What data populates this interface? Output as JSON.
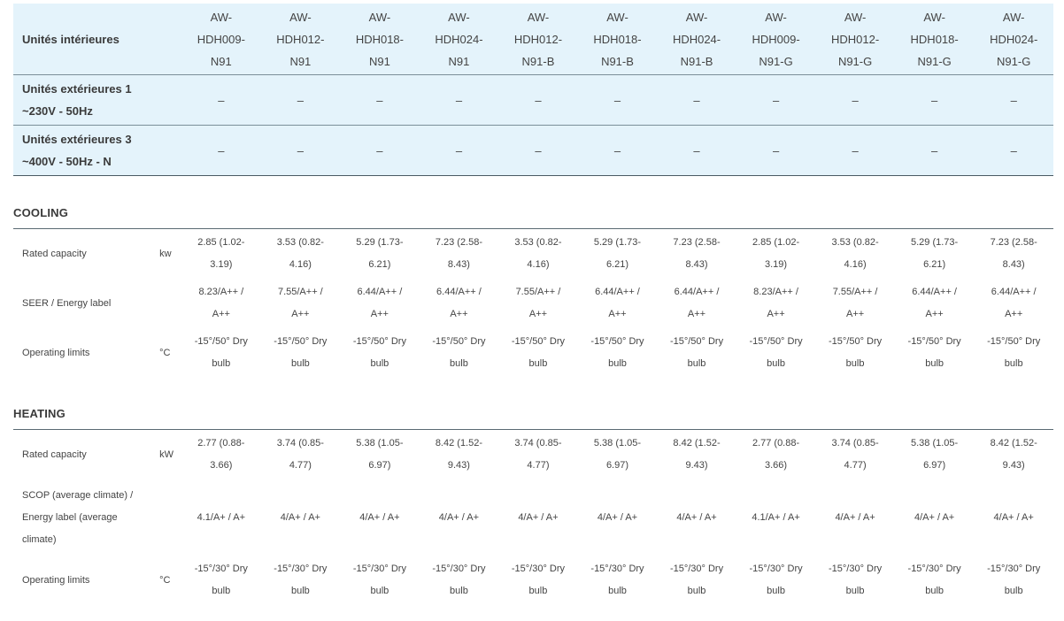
{
  "header": {
    "indoor_label": "Unités intérieures",
    "models": [
      [
        "AW-",
        "HDH009-",
        "N91"
      ],
      [
        "AW-",
        "HDH012-",
        "N91"
      ],
      [
        "AW-",
        "HDH018-",
        "N91"
      ],
      [
        "AW-",
        "HDH024-",
        "N91"
      ],
      [
        "AW-",
        "HDH012-",
        "N91-B"
      ],
      [
        "AW-",
        "HDH018-",
        "N91-B"
      ],
      [
        "AW-",
        "HDH024-",
        "N91-B"
      ],
      [
        "AW-",
        "HDH009-",
        "N91-G"
      ],
      [
        "AW-",
        "HDH012-",
        "N91-G"
      ],
      [
        "AW-",
        "HDH018-",
        "N91-G"
      ],
      [
        "AW-",
        "HDH024-",
        "N91-G"
      ]
    ],
    "outdoor_rows": [
      {
        "label": [
          "Unités extérieures 1",
          "~230V - 50Hz"
        ],
        "dash": "–"
      },
      {
        "label": [
          "Unités extérieures 3",
          "~400V - 50Hz - N"
        ],
        "dash": "–"
      }
    ]
  },
  "cooling": {
    "title": "COOLING",
    "rows": [
      {
        "label": [
          "Rated capacity"
        ],
        "unit": "kw",
        "values": [
          [
            "2.85 (1.02-",
            "3.19)"
          ],
          [
            "3.53 (0.82-",
            "4.16)"
          ],
          [
            "5.29 (1.73-",
            "6.21)"
          ],
          [
            "7.23 (2.58-",
            "8.43)"
          ],
          [
            "3.53 (0.82-",
            "4.16)"
          ],
          [
            "5.29 (1.73-",
            "6.21)"
          ],
          [
            "7.23 (2.58-",
            "8.43)"
          ],
          [
            "2.85 (1.02-",
            "3.19)"
          ],
          [
            "3.53 (0.82-",
            "4.16)"
          ],
          [
            "5.29 (1.73-",
            "6.21)"
          ],
          [
            "7.23 (2.58-",
            "8.43)"
          ]
        ]
      },
      {
        "label": [
          "SEER / Energy label"
        ],
        "unit": "",
        "values": [
          [
            "8.23/A++ /",
            "A++"
          ],
          [
            "7.55/A++ /",
            "A++"
          ],
          [
            "6.44/A++ /",
            "A++"
          ],
          [
            "6.44/A++ /",
            "A++"
          ],
          [
            "7.55/A++ /",
            "A++"
          ],
          [
            "6.44/A++ /",
            "A++"
          ],
          [
            "6.44/A++ /",
            "A++"
          ],
          [
            "8.23/A++ /",
            "A++"
          ],
          [
            "7.55/A++ /",
            "A++"
          ],
          [
            "6.44/A++ /",
            "A++"
          ],
          [
            "6.44/A++ /",
            "A++"
          ]
        ]
      },
      {
        "label": [
          "Operating limits"
        ],
        "unit": "°C",
        "values": [
          [
            "-15°/50° Dry",
            "bulb"
          ],
          [
            "-15°/50° Dry",
            "bulb"
          ],
          [
            "-15°/50° Dry",
            "bulb"
          ],
          [
            "-15°/50° Dry",
            "bulb"
          ],
          [
            "-15°/50° Dry",
            "bulb"
          ],
          [
            "-15°/50° Dry",
            "bulb"
          ],
          [
            "-15°/50° Dry",
            "bulb"
          ],
          [
            "-15°/50° Dry",
            "bulb"
          ],
          [
            "-15°/50° Dry",
            "bulb"
          ],
          [
            "-15°/50° Dry",
            "bulb"
          ],
          [
            "-15°/50° Dry",
            "bulb"
          ]
        ]
      }
    ]
  },
  "heating": {
    "title": "HEATING",
    "rows": [
      {
        "label": [
          "Rated capacity"
        ],
        "unit": "kW",
        "values": [
          [
            "2.77 (0.88-",
            "3.66)"
          ],
          [
            "3.74 (0.85-",
            "4.77)"
          ],
          [
            "5.38 (1.05-",
            "6.97)"
          ],
          [
            "8.42 (1.52-",
            "9.43)"
          ],
          [
            "3.74 (0.85-",
            "4.77)"
          ],
          [
            "5.38 (1.05-",
            "6.97)"
          ],
          [
            "8.42 (1.52-",
            "9.43)"
          ],
          [
            "2.77 (0.88-",
            "3.66)"
          ],
          [
            "3.74 (0.85-",
            "4.77)"
          ],
          [
            "5.38 (1.05-",
            "6.97)"
          ],
          [
            "8.42 (1.52-",
            "9.43)"
          ]
        ]
      },
      {
        "label": [
          "SCOP (average climate) /",
          "Energy label (average",
          "climate)"
        ],
        "unit": "",
        "values": [
          [
            "4.1/A+ / A+"
          ],
          [
            "4/A+ / A+"
          ],
          [
            "4/A+ / A+"
          ],
          [
            "4/A+ / A+"
          ],
          [
            "4/A+ / A+"
          ],
          [
            "4/A+ / A+"
          ],
          [
            "4/A+ / A+"
          ],
          [
            "4.1/A+ / A+"
          ],
          [
            "4/A+ / A+"
          ],
          [
            "4/A+ / A+"
          ],
          [
            "4/A+ / A+"
          ]
        ]
      },
      {
        "label": [
          "Operating limits"
        ],
        "unit": "°C",
        "values": [
          [
            "-15°/30° Dry",
            "bulb"
          ],
          [
            "-15°/30° Dry",
            "bulb"
          ],
          [
            "-15°/30° Dry",
            "bulb"
          ],
          [
            "-15°/30° Dry",
            "bulb"
          ],
          [
            "-15°/30° Dry",
            "bulb"
          ],
          [
            "-15°/30° Dry",
            "bulb"
          ],
          [
            "-15°/30° Dry",
            "bulb"
          ],
          [
            "-15°/30° Dry",
            "bulb"
          ],
          [
            "-15°/30° Dry",
            "bulb"
          ],
          [
            "-15°/30° Dry",
            "bulb"
          ],
          [
            "-15°/30° Dry",
            "bulb"
          ]
        ]
      }
    ]
  }
}
